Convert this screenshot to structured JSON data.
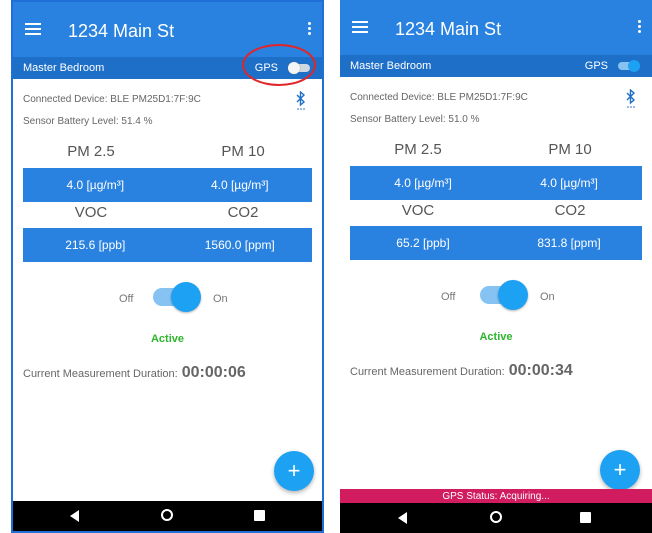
{
  "screens": [
    {
      "app_title": "1234 Main St",
      "room": "Master Bedroom",
      "gps_label": "GPS",
      "gps_enabled": false,
      "connected_device": "Connected Device:  BLE PM25D1:7F:9C",
      "battery": "Sensor Battery Level:  51.4 %",
      "pm25_label": "PM 2.5",
      "pm10_label": "PM 10",
      "pm25_value": "4.0 [µg/m³]",
      "pm10_value": "4.0 [µg/m³]",
      "voc_label": "VOC",
      "co2_label": "CO2",
      "voc_value": "215.6 [ppb]",
      "co2_value": "1560.0 [ppm]",
      "off_label": "Off",
      "on_label": "On",
      "status": "Active",
      "duration_label": "Current Measurement Duration:",
      "duration_value": "00:00:06",
      "fab_symbol": "+"
    },
    {
      "app_title": "1234 Main St",
      "room": "Master Bedroom",
      "gps_label": "GPS",
      "gps_enabled": true,
      "connected_device": "Connected Device:  BLE PM25D1:7F:9C",
      "battery": "Sensor Battery Level:  51.0 %",
      "pm25_label": "PM 2.5",
      "pm10_label": "PM 10",
      "pm25_value": "4.0 [µg/m³]",
      "pm10_value": "4.0 [µg/m³]",
      "voc_label": "VOC",
      "co2_label": "CO2",
      "voc_value": "65.2 [ppb]",
      "co2_value": "831.8 [ppm]",
      "off_label": "Off",
      "on_label": "On",
      "status": "Active",
      "duration_label": "Current Measurement Duration:",
      "duration_value": "00:00:34",
      "fab_symbol": "+",
      "gps_status": "GPS Status: Acquiring..."
    }
  ],
  "colors": {
    "appbar": "#2a82e0",
    "roombar": "#1e6fc7",
    "accent": "#1da1f2",
    "active": "#2db52d",
    "gps_status_bar": "#d11c5f",
    "highlight": "#e0262a"
  }
}
